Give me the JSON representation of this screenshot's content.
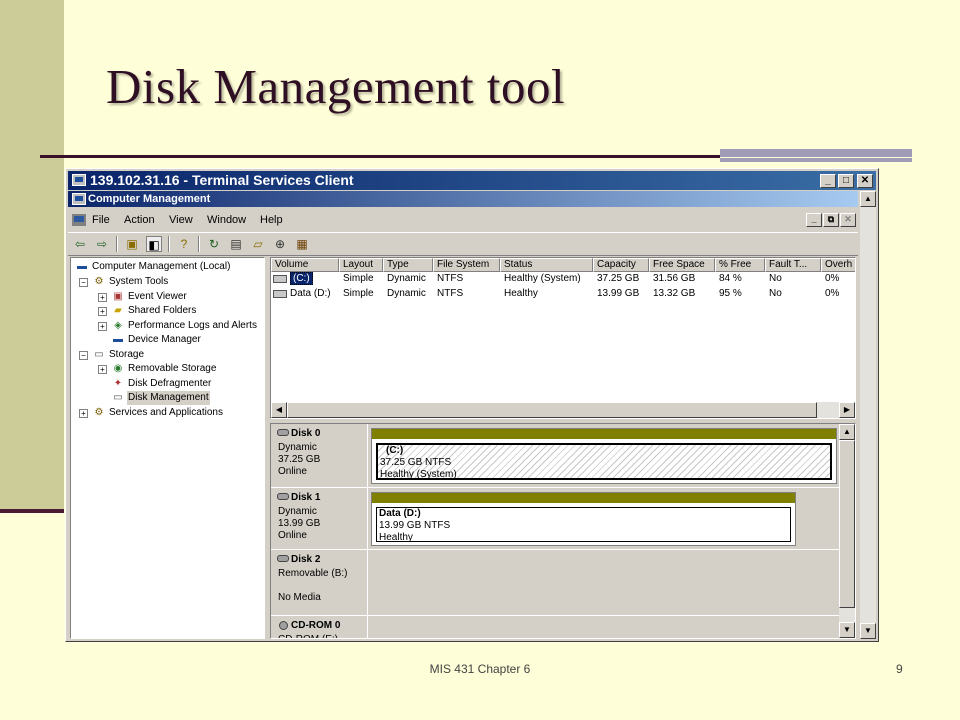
{
  "slide": {
    "title": "Disk Management tool",
    "footer": "MIS 431 Chapter 6",
    "page_number": "9"
  },
  "ts_window": {
    "title": "139.102.31.16 - Terminal Services Client",
    "buttons": [
      "_",
      "□",
      "✕"
    ]
  },
  "cm_window": {
    "title": "Computer Management",
    "mdi_buttons": [
      "_",
      "⧉",
      "✕"
    ]
  },
  "menu": {
    "items": [
      "File",
      "Action",
      "View",
      "Window",
      "Help"
    ]
  },
  "toolbar": {
    "icons": [
      "back-arrow-icon",
      "forward-arrow-icon",
      "up-folder-icon",
      "show-hide-tree-icon",
      "help-icon",
      "refresh-icon",
      "properties-icon",
      "open-icon",
      "zoom-icon",
      "export-icon"
    ]
  },
  "tree": {
    "items": [
      {
        "label": "Computer Management (Local)",
        "level": 0,
        "expander": "",
        "icon": "computer-icon"
      },
      {
        "label": "System Tools",
        "level": 1,
        "expander": "−",
        "icon": "tools-icon"
      },
      {
        "label": "Event Viewer",
        "level": 2,
        "expander": "+",
        "icon": "event-viewer-icon"
      },
      {
        "label": "Shared Folders",
        "level": 2,
        "expander": "+",
        "icon": "shared-folder-icon"
      },
      {
        "label": "Performance Logs and Alerts",
        "level": 2,
        "expander": "+",
        "icon": "performance-icon"
      },
      {
        "label": "Device Manager",
        "level": 2,
        "expander": "",
        "icon": "device-manager-icon"
      },
      {
        "label": "Storage",
        "level": 1,
        "expander": "−",
        "icon": "storage-icon"
      },
      {
        "label": "Removable Storage",
        "level": 2,
        "expander": "+",
        "icon": "removable-storage-icon"
      },
      {
        "label": "Disk Defragmenter",
        "level": 2,
        "expander": "",
        "icon": "defragmenter-icon"
      },
      {
        "label": "Disk Management",
        "level": 2,
        "expander": "",
        "icon": "disk-management-icon",
        "selected": true
      },
      {
        "label": "Services and Applications",
        "level": 1,
        "expander": "+",
        "icon": "services-icon"
      }
    ]
  },
  "volume_list": {
    "columns": [
      "Volume",
      "Layout",
      "Type",
      "File System",
      "Status",
      "Capacity",
      "Free Space",
      "% Free",
      "Fault T...",
      "Overh"
    ],
    "rows": [
      [
        "(C:)",
        "Simple",
        "Dynamic",
        "NTFS",
        "Healthy (System)",
        "37.25 GB",
        "31.56 GB",
        "84 %",
        "No",
        "0%"
      ],
      [
        "Data (D:)",
        "Simple",
        "Dynamic",
        "NTFS",
        "Healthy",
        "13.99 GB",
        "13.32 GB",
        "95 %",
        "No",
        "0%"
      ]
    ]
  },
  "disks": [
    {
      "name": "Disk 0",
      "type": "Dynamic",
      "size": "37.25 GB",
      "status": "Online",
      "volume": {
        "name": "(C:)",
        "size": "37.25 GB NTFS",
        "status": "Healthy (System)"
      }
    },
    {
      "name": "Disk 1",
      "type": "Dynamic",
      "size": "13.99 GB",
      "status": "Online",
      "volume": {
        "name": "Data  (D:)",
        "size": "13.99 GB NTFS",
        "status": "Healthy"
      }
    },
    {
      "name": "Disk 2",
      "type": "Removable (B:)",
      "status": "No Media"
    },
    {
      "name": "CD-ROM 0",
      "type": "CD-ROM (E:)"
    }
  ],
  "colors": {
    "slide_bg": "#fefed8",
    "left_band": "#cccc99",
    "title_text": "#2e0f24",
    "volume_bar": "#808000",
    "titlebar_active": "#0a246a"
  }
}
